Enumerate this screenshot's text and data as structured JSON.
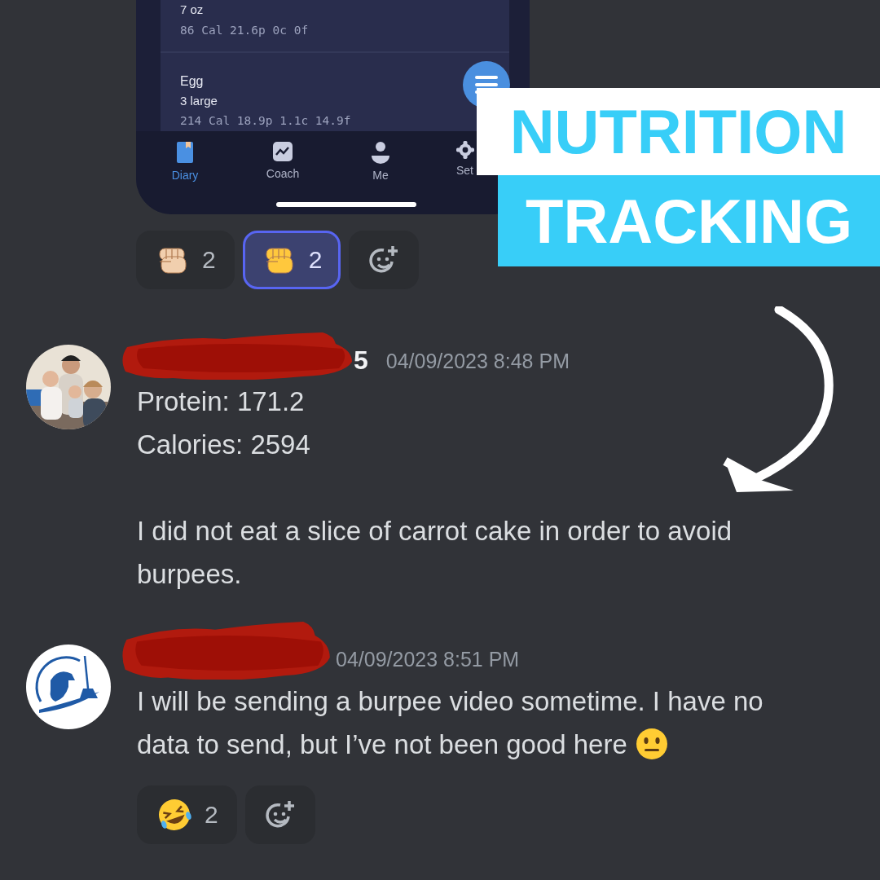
{
  "phone_screen": {
    "food_entries": [
      {
        "serving": "7 oz",
        "macros": "86 Cal 21.6p 0c 0f"
      },
      {
        "name": "Egg",
        "serving": "3 large",
        "macros": "214 Cal 18.9p 1.1c 14.9f"
      }
    ],
    "nav_tabs": [
      {
        "label": "Diary",
        "kind": "book",
        "selected": true
      },
      {
        "label": "Coach",
        "kind": "chart",
        "selected": false
      },
      {
        "label": "Me",
        "kind": "person",
        "selected": false
      },
      {
        "label": "Set",
        "kind": "gear",
        "selected": false
      }
    ]
  },
  "top_reactions": [
    {
      "kind": "fist",
      "color": "#f1cfae",
      "count": "2",
      "selected": false
    },
    {
      "kind": "fist",
      "color": "#ffc83d",
      "count": "2",
      "selected": true
    },
    {
      "kind": "add"
    }
  ],
  "banner": {
    "lines": [
      "NUTRITION",
      "TRACKING"
    ]
  },
  "messages": [
    {
      "avatar": {
        "kind": "picture"
      },
      "username": "5",
      "timestamp": "04/09/2023 8:48 PM",
      "paragraphs": [
        "Protein: 171.2\nCalories: 2594",
        "I did not eat a slice of carrot cake in order to avoid burpees."
      ]
    },
    {
      "avatar": {
        "kind": "logo"
      },
      "timestamp": "04/09/2023 8:51 PM",
      "paragraphs": [
        "I will be sending a burpee video sometime. I have no data to send, but I’ve not been good here"
      ],
      "end_icon": {
        "kind": "neutral-face"
      },
      "reactions": [
        {
          "kind": "laugh",
          "count": "2",
          "selected": false
        },
        {
          "kind": "add"
        }
      ]
    }
  ]
}
